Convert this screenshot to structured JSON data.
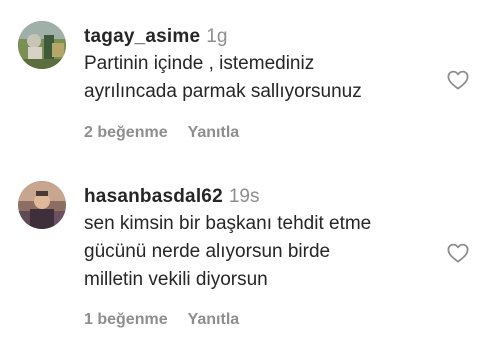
{
  "comments": [
    {
      "username": "tagay_asime",
      "time": "1g",
      "text_line1": "Partinin içinde , istemediniz",
      "text_line2": "ayrılıncada parmak sallıyorsunuz",
      "likes": "2 beğenme",
      "reply_label": "Yanıtla",
      "avatar_icon": "profile-photo",
      "like_icon": "heart-outline-icon"
    },
    {
      "username": "hasanbasdal62",
      "time": "19s",
      "text_line1": "sen kimsin bir başkanı tehdit etme",
      "text_line2": "gücünü nerde alıyorsun birde",
      "text_line3": "milletin vekili diyorsun",
      "likes": "1 beğenme",
      "reply_label": "Yanıtla",
      "avatar_icon": "profile-photo",
      "like_icon": "heart-outline-icon"
    }
  ],
  "colors": {
    "primary_text": "#262626",
    "secondary_text": "#8e8e8e",
    "background": "#ffffff"
  }
}
